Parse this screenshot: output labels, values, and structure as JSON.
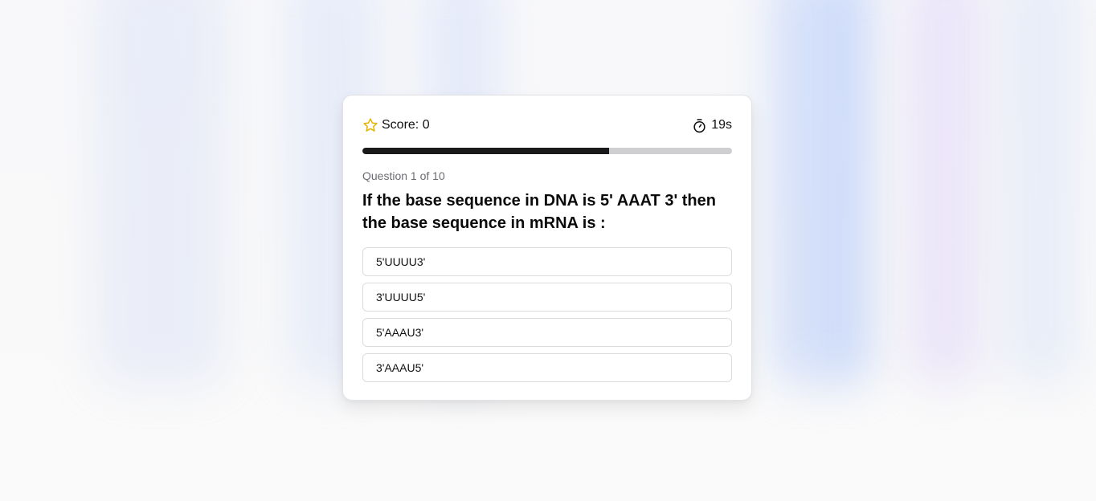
{
  "header": {
    "score_label": "Score: 0",
    "timer_label": "19s"
  },
  "progress": {
    "fraction": 0.667
  },
  "question": {
    "counter": "Question 1 of 10",
    "text": "If the base sequence in DNA is 5' AAAT 3' then the base sequence in mRNA is :"
  },
  "options": [
    {
      "label": "5'UUUU3'"
    },
    {
      "label": "3'UUUU5'"
    },
    {
      "label": "5'AAAU3'"
    },
    {
      "label": "3'AAAU5'"
    }
  ],
  "icons": {
    "score": "star-icon",
    "timer": "stopwatch-icon"
  },
  "colors": {
    "star": "#e6b400",
    "progress_fill": "#1a1a1a",
    "progress_track": "#cfcfd1"
  }
}
